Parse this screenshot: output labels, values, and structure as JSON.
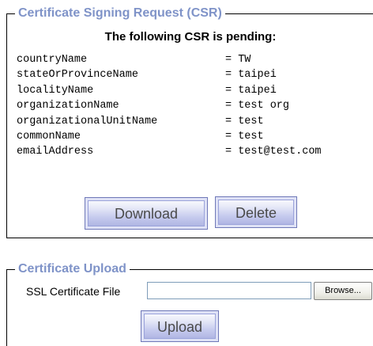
{
  "csr_section": {
    "legend": "Certificate Signing Request (CSR)",
    "pending_title": "The following CSR is pending:",
    "fields": [
      {
        "key": "countryName",
        "value": "= TW"
      },
      {
        "key": "stateOrProvinceName",
        "value": "= taipei"
      },
      {
        "key": "localityName",
        "value": "= taipei"
      },
      {
        "key": "organizationName",
        "value": "= test org"
      },
      {
        "key": "organizationalUnitName",
        "value": "= test"
      },
      {
        "key": "commonName",
        "value": "= test"
      },
      {
        "key": "emailAddress",
        "value": "= test@test.com"
      }
    ],
    "download_label": "Download",
    "delete_label": "Delete"
  },
  "upload_section": {
    "legend": "Certificate Upload",
    "file_label": "SSL Certificate File",
    "file_value": "",
    "browse_label": "Browse...",
    "upload_label": "Upload"
  },
  "colors": {
    "legend": "#7f93c8",
    "button_border": "#6f78b8",
    "button_text": "#4a4a4a"
  }
}
